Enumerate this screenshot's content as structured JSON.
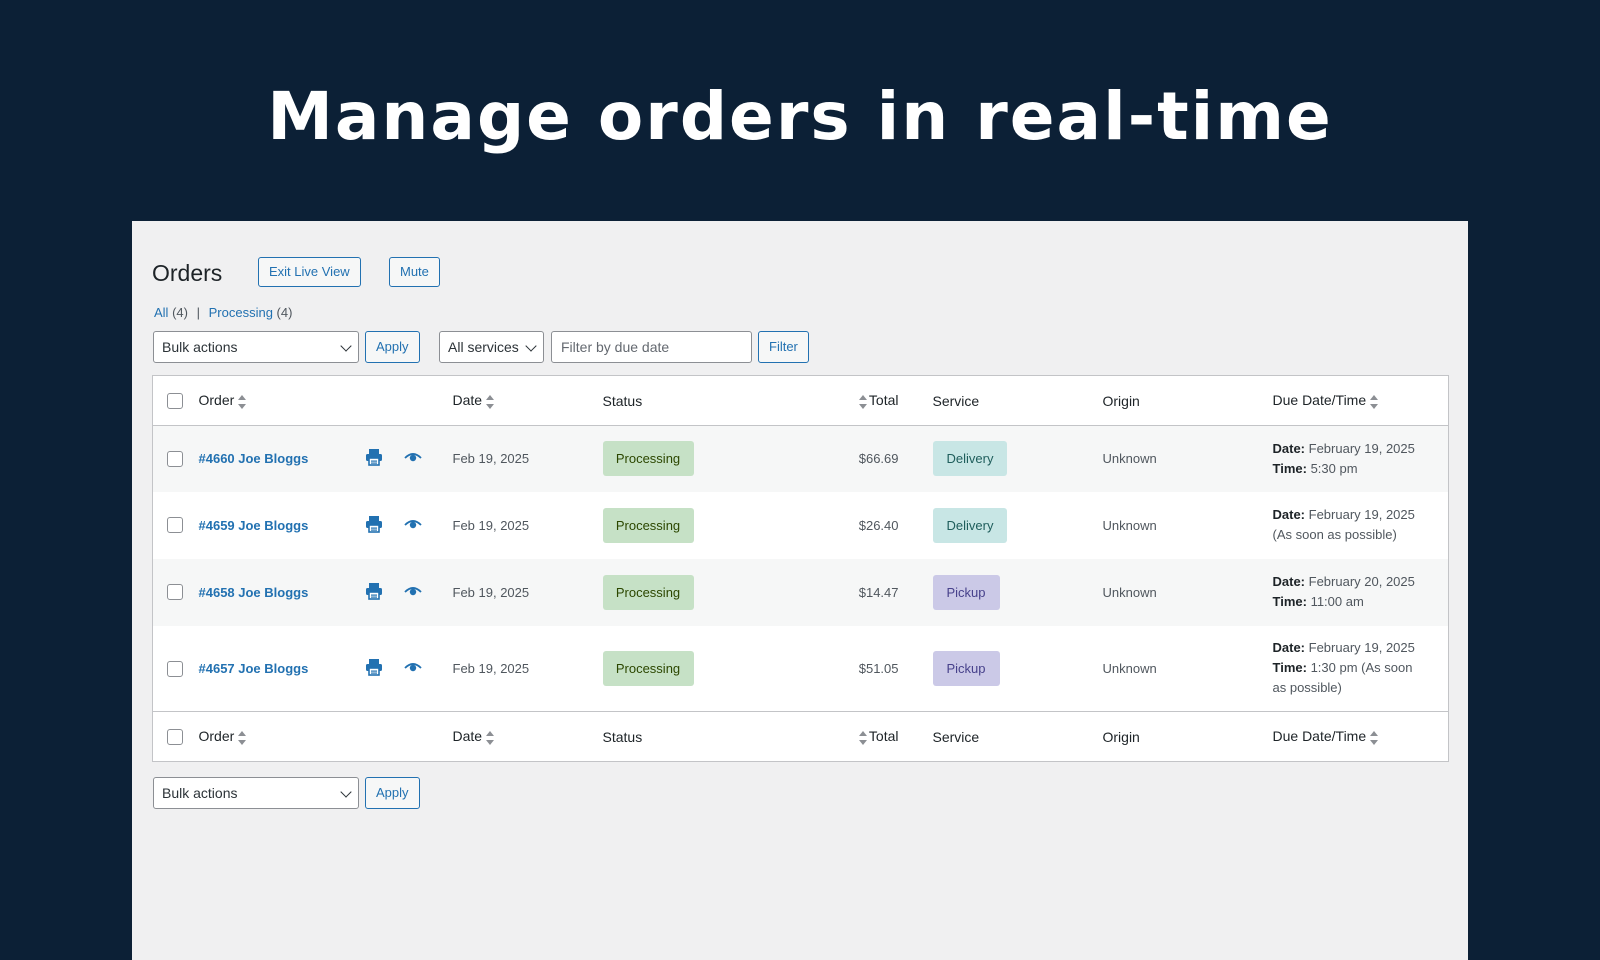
{
  "hero": {
    "title": "Manage orders in real-time"
  },
  "header": {
    "title": "Orders",
    "exit_live_view": "Exit Live View",
    "mute": "Mute"
  },
  "views": {
    "all_label": "All",
    "all_count": "(4)",
    "separator": "|",
    "processing_label": "Processing",
    "processing_count": "(4)"
  },
  "filters": {
    "bulk_actions": "Bulk actions",
    "apply": "Apply",
    "services": "All services",
    "due_date_placeholder": "Filter by due date",
    "filter": "Filter"
  },
  "table": {
    "columns": {
      "order": "Order",
      "date": "Date",
      "status": "Status",
      "total": "Total",
      "service": "Service",
      "origin": "Origin",
      "due": "Due Date/Time"
    },
    "rows": [
      {
        "order": "#4660 Joe Bloggs",
        "date": "Feb 19, 2025",
        "status": "Processing",
        "total": "$66.69",
        "service": "Delivery",
        "origin": "Unknown",
        "due_label": "Date:",
        "due_date": "February 19, 2025",
        "due_line2_label": "Time:",
        "due_line2": "5:30 pm"
      },
      {
        "order": "#4659 Joe Bloggs",
        "date": "Feb 19, 2025",
        "status": "Processing",
        "total": "$26.40",
        "service": "Delivery",
        "origin": "Unknown",
        "due_label": "Date:",
        "due_date": "February 19, 2025",
        "due_line2_label": "",
        "due_line2": "(As soon as possible)"
      },
      {
        "order": "#4658 Joe Bloggs",
        "date": "Feb 19, 2025",
        "status": "Processing",
        "total": "$14.47",
        "service": "Pickup",
        "origin": "Unknown",
        "due_label": "Date:",
        "due_date": "February 20, 2025",
        "due_line2_label": "Time:",
        "due_line2": "11:00 am"
      },
      {
        "order": "#4657 Joe Bloggs",
        "date": "Feb 19, 2025",
        "status": "Processing",
        "total": "$51.05",
        "service": "Pickup",
        "origin": "Unknown",
        "due_label": "Date:",
        "due_date": "February 19, 2025",
        "due_line2_label": "Time:",
        "due_line2": "1:30 pm (As soon as possible)"
      }
    ]
  },
  "colors": {
    "background": "#0c2036",
    "panel": "#f0f0f1",
    "link": "#2271b1",
    "processing_bg": "#c6e1c6",
    "delivery_bg": "#c8e6e5",
    "pickup_bg": "#cbc9e7"
  },
  "icons": {
    "print": "printer-icon",
    "preview": "eye-icon"
  }
}
